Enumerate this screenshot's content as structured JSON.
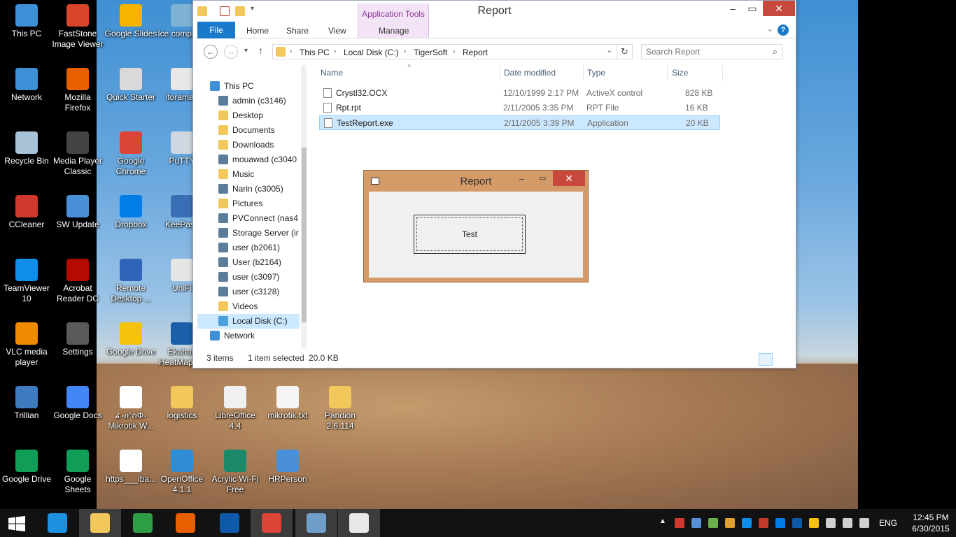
{
  "desktop": {
    "icons": [
      {
        "label": "This PC",
        "icon": "computer-icon",
        "color": "#3d8fd6"
      },
      {
        "label": "FastStone Image Viewer",
        "icon": "faststone-icon",
        "color": "#d9452b"
      },
      {
        "label": "Google Slides",
        "icon": "slides-icon",
        "color": "#f4b400"
      },
      {
        "label": "Ice computer",
        "icon": "ice-icon",
        "color": "#7fb3d5"
      },
      {
        "label": "Network",
        "icon": "network-icon",
        "color": "#3d8fd6"
      },
      {
        "label": "Mozilla Firefox",
        "icon": "firefox-icon",
        "color": "#e66000"
      },
      {
        "label": "Quick Starter",
        "icon": "quickstarter-icon",
        "color": "#d9d9d9"
      },
      {
        "label": "itorama_",
        "icon": "itorama-icon",
        "color": "#e8e8e8"
      },
      {
        "label": "Recycle Bin",
        "icon": "recycle-bin-icon",
        "color": "#a8c3d8"
      },
      {
        "label": "Media Player Classic",
        "icon": "mpc-icon",
        "color": "#444444"
      },
      {
        "label": "Google Chrome",
        "icon": "chrome-icon",
        "color": "#db4437"
      },
      {
        "label": "PuTTY",
        "icon": "putty-icon",
        "color": "#cfd8e0"
      },
      {
        "label": "CCleaner",
        "icon": "ccleaner-icon",
        "color": "#d0392e"
      },
      {
        "label": "SW Update",
        "icon": "sw-update-icon",
        "color": "#4a90d9"
      },
      {
        "label": "Dropbox",
        "icon": "dropbox-icon",
        "color": "#007ee5"
      },
      {
        "label": "KeePass",
        "icon": "keepass-icon",
        "color": "#3a6fb5"
      },
      {
        "label": "TeamViewer 10",
        "icon": "teamviewer-icon",
        "color": "#0e8ee9"
      },
      {
        "label": "Acrobat Reader DC",
        "icon": "acrobat-icon",
        "color": "#b30b00"
      },
      {
        "label": "Remote Desktop ...",
        "icon": "remote-desktop-icon",
        "color": "#2f64b8"
      },
      {
        "label": "UniFi",
        "icon": "unifi-icon",
        "color": "#e6e6e6"
      },
      {
        "label": "VLC media player",
        "icon": "vlc-icon",
        "color": "#f08a00"
      },
      {
        "label": "Settings",
        "icon": "settings-icon",
        "color": "#5a5a5a"
      },
      {
        "label": "Google Drive",
        "icon": "google-drive-icon",
        "color": "#f4c20d"
      },
      {
        "label": "Ekahau HeatMapper",
        "icon": "ekahau-icon",
        "color": "#1a5fa8"
      },
      {
        "label": "Trillian",
        "icon": "trillian-icon",
        "color": "#3f7bbf"
      },
      {
        "label": "Google Docs",
        "icon": "docs-icon",
        "color": "#4285f4"
      },
      {
        "label": "ፊ-ዐ°ስΦ-Mikrotik W...",
        "icon": "pdf-icon",
        "color": "#ffffff"
      },
      {
        "label": "logistics",
        "icon": "folder-icon",
        "color": "#f2c75c"
      },
      {
        "label": "LibreOffice 4.4",
        "icon": "libreoffice-icon",
        "color": "#f0f0f0"
      },
      {
        "label": "mikrotik.txt",
        "icon": "text-file-icon",
        "color": "#f5f5f5"
      },
      {
        "label": "Pandion 2.6.114",
        "icon": "folder-icon",
        "color": "#f2c75c"
      },
      {
        "label": "Google Drive",
        "icon": "google-drive-icon",
        "color": "#0f9d58"
      },
      {
        "label": "Google Sheets",
        "icon": "sheets-icon",
        "color": "#0f9d58"
      },
      {
        "label": "https___iba...",
        "icon": "pdf-icon",
        "color": "#ffffff"
      },
      {
        "label": "OpenOffice 4.1.1",
        "icon": "openoffice-icon",
        "color": "#2f8dd6"
      },
      {
        "label": "Acrylic Wi-Fi Free",
        "icon": "acrylic-icon",
        "color": "#1c8a6a"
      },
      {
        "label": "HRPerson",
        "icon": "hrperson-icon",
        "color": "#4a90d9"
      }
    ]
  },
  "explorer": {
    "title": "Report",
    "context_tab_group": "Application Tools",
    "tabs": [
      "File",
      "Home",
      "Share",
      "View",
      "Manage"
    ],
    "breadcrumb": [
      "This PC",
      "Local Disk (C:)",
      "TigerSoft",
      "Report"
    ],
    "search_placeholder": "Search Report",
    "nav_items": [
      {
        "label": "This PC",
        "icon": "computer-icon",
        "color": "#3d8fd6",
        "indent": 0
      },
      {
        "label": "admin (c3146)",
        "icon": "network-drive-icon",
        "color": "#5c7d9a",
        "indent": 1
      },
      {
        "label": "Desktop",
        "icon": "folder-icon",
        "color": "#f2c75c",
        "indent": 1
      },
      {
        "label": "Documents",
        "icon": "folder-icon",
        "color": "#f2c75c",
        "indent": 1
      },
      {
        "label": "Downloads",
        "icon": "folder-icon",
        "color": "#f2c75c",
        "indent": 1
      },
      {
        "label": "mouawad (c3040",
        "icon": "network-drive-icon",
        "color": "#5c7d9a",
        "indent": 1
      },
      {
        "label": "Music",
        "icon": "folder-icon",
        "color": "#f2c75c",
        "indent": 1
      },
      {
        "label": "Narin (c3005)",
        "icon": "network-drive-icon",
        "color": "#5c7d9a",
        "indent": 1
      },
      {
        "label": "Pictures",
        "icon": "folder-icon",
        "color": "#f2c75c",
        "indent": 1
      },
      {
        "label": "PVConnect (nas4",
        "icon": "network-drive-icon",
        "color": "#5c7d9a",
        "indent": 1
      },
      {
        "label": "Storage Server (ir",
        "icon": "network-drive-icon",
        "color": "#5c7d9a",
        "indent": 1
      },
      {
        "label": "user (b2061)",
        "icon": "network-drive-icon",
        "color": "#5c7d9a",
        "indent": 1
      },
      {
        "label": "User (b2164)",
        "icon": "network-drive-icon",
        "color": "#5c7d9a",
        "indent": 1
      },
      {
        "label": "user (c3097)",
        "icon": "network-drive-icon",
        "color": "#5c7d9a",
        "indent": 1
      },
      {
        "label": "user (c3128)",
        "icon": "network-drive-icon",
        "color": "#5c7d9a",
        "indent": 1
      },
      {
        "label": "Videos",
        "icon": "folder-icon",
        "color": "#f2c75c",
        "indent": 1
      },
      {
        "label": "Local Disk (C:)",
        "icon": "local-disk-icon",
        "color": "#4a9fd8",
        "indent": 1,
        "selected": true
      },
      {
        "label": "Network",
        "icon": "network-icon",
        "color": "#3d8fd6",
        "indent": 0
      }
    ],
    "columns": [
      "Name",
      "Date modified",
      "Type",
      "Size"
    ],
    "files": [
      {
        "name": "Crystl32.OCX",
        "date": "12/10/1999 2:17 PM",
        "type": "ActiveX control",
        "size": "828 KB",
        "selected": false
      },
      {
        "name": "Rpt.rpt",
        "date": "2/11/2005 3:35 PM",
        "type": "RPT File",
        "size": "16 KB",
        "selected": false
      },
      {
        "name": "TestReport.exe",
        "date": "2/11/2005 3:39 PM",
        "type": "Application",
        "size": "20 KB",
        "selected": true
      }
    ],
    "status": {
      "items": "3 items",
      "selected": "1 item selected",
      "size": "20.0 KB"
    }
  },
  "report_window": {
    "title": "Report",
    "button_label": "Test"
  },
  "taskbar": {
    "apps": [
      {
        "name": "internet-explorer",
        "icon": "ie-icon",
        "color": "#1e90e0",
        "open": false
      },
      {
        "name": "file-explorer",
        "icon": "file-explorer-icon",
        "color": "#f2c75c",
        "open": true
      },
      {
        "name": "store",
        "icon": "store-icon",
        "color": "#2e9e44",
        "open": false
      },
      {
        "name": "firefox",
        "icon": "firefox-icon",
        "color": "#e66000",
        "open": false
      },
      {
        "name": "outlook",
        "icon": "outlook-icon",
        "color": "#0f5aa8",
        "open": false
      },
      {
        "name": "chrome",
        "icon": "chrome-icon",
        "color": "#db4437",
        "open": true
      },
      {
        "name": "photos",
        "icon": "photos-icon",
        "color": "#6f9fc9",
        "open": true
      },
      {
        "name": "report-app",
        "icon": "app-window-icon",
        "color": "#e8e8e8",
        "open": true
      }
    ],
    "language": "ENG",
    "time": "12:45 PM",
    "date": "6/30/2015"
  }
}
